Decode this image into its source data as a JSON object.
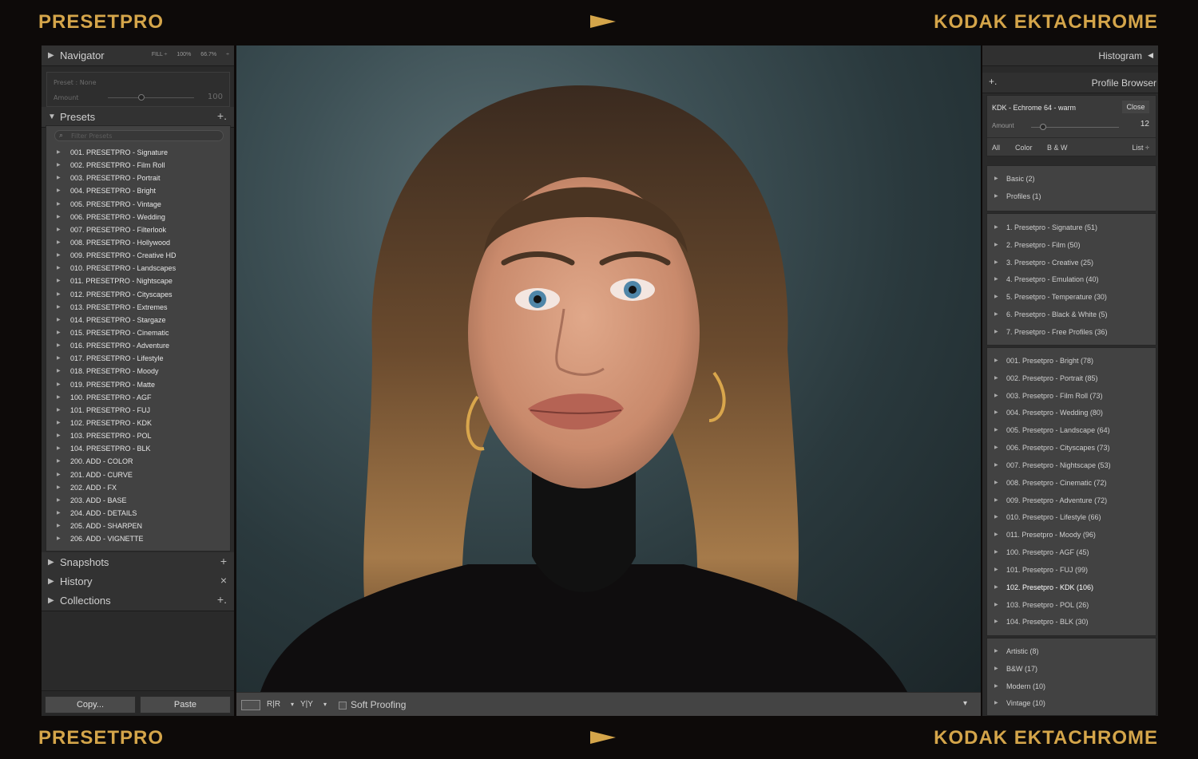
{
  "banner": {
    "brand_left": "PRESETPRO",
    "brand_right": "KODAK EKTACHROME",
    "accent_color": "#d4a54a"
  },
  "left_panel": {
    "navigator": {
      "title": "Navigator",
      "opt_fill": "FILL ÷",
      "opt_100": "100%",
      "opt_zoom": "66.7%",
      "opt_more": "÷"
    },
    "preset_info": {
      "name": "Preset : None",
      "amount_label": "Amount",
      "amount_value": "100"
    },
    "presets": {
      "title": "Presets",
      "filter_placeholder": "Filter Presets",
      "items": [
        "001. PRESETPRO - Signature",
        "002. PRESETPRO - Film Roll",
        "003. PRESETPRO - Portrait",
        "004. PRESETPRO - Bright",
        "005. PRESETPRO - Vintage",
        "006. PRESETPRO - Wedding",
        "007. PRESETPRO - Filterlook",
        "008. PRESETPRO - Hollywood",
        "009. PRESETPRO - Creative HD",
        "010. PRESETPRO - Landscapes",
        "011. PRESETPRO - Nightscape",
        "012. PRESETPRO - Cityscapes",
        "013. PRESETPRO - Extremes",
        "014. PRESETPRO - Stargaze",
        "015. PRESETPRO - Cinematic",
        "016. PRESETPRO - Adventure",
        "017. PRESETPRO - Lifestyle",
        "018. PRESETPRO - Moody",
        "019. PRESETPRO - Matte",
        "100. PRESETPRO - AGF",
        "101. PRESETPRO - FUJ",
        "102. PRESETPRO - KDK",
        "103. PRESETPRO - POL",
        "104. PRESETPRO - BLK",
        "200. ADD - COLOR",
        "201. ADD - CURVE",
        "202. ADD - FX",
        "203. ADD - BASE",
        "204. ADD - DETAILS",
        "205. ADD - SHARPEN",
        "206. ADD - VIGNETTE"
      ]
    },
    "snapshots": {
      "title": "Snapshots",
      "action": "+"
    },
    "history": {
      "title": "History",
      "action": "×"
    },
    "collections": {
      "title": "Collections",
      "action": "+."
    },
    "copy_label": "Copy...",
    "paste_label": "Paste"
  },
  "toolbar": {
    "soft_proofing": "Soft Proofing",
    "rr_label": "R|R",
    "yy_label": "Y|Y"
  },
  "right_panel": {
    "histogram": "Histogram",
    "profile_browser": "Profile Browser",
    "profile": {
      "name": "KDK - Echrome 64 - warm",
      "close": "Close",
      "amount_label": "Amount",
      "amount_value": "12",
      "tabs": {
        "all": "All",
        "color": "Color",
        "bw": "B & W",
        "view": "List ÷"
      }
    },
    "group1": [
      "Basic (2)",
      "Profiles (1)"
    ],
    "group2": [
      "1. Presetpro - Signature (51)",
      "2. Presetpro - Film (50)",
      "3. Presetpro - Creative (25)",
      "4. Presetpro - Emulation (40)",
      "5. Presetpro - Temperature (30)",
      "6. Presetpro - Black & White (5)",
      "7. Presetpro - Free Profiles (36)"
    ],
    "group3": [
      "001. Presetpro - Bright (78)",
      "002. Presetpro - Portrait (85)",
      "003. Presetpro - Film Roll (73)",
      "004. Presetpro - Wedding (80)",
      "005. Presetpro - Landscape (64)",
      "006. Presetpro - Cityscapes (73)",
      "007. Presetpro - Nightscape (53)",
      "008. Presetpro - Cinematic (72)",
      "009. Presetpro - Adventure (72)",
      "010. Presetpro - Lifestyle (66)",
      "011. Presetpro - Moody (96)",
      "100. Presetpro - AGF (45)",
      "101. Presetpro - FUJ (99)",
      "102. Presetpro - KDK (106)",
      "103. Presetpro - POL (26)",
      "104. Presetpro - BLK (30)"
    ],
    "group3_selected": "102. Presetpro - KDK (106)",
    "group4": [
      "Artistic (8)",
      "B&W (17)",
      "Modern (10)",
      "Vintage (10)"
    ]
  }
}
